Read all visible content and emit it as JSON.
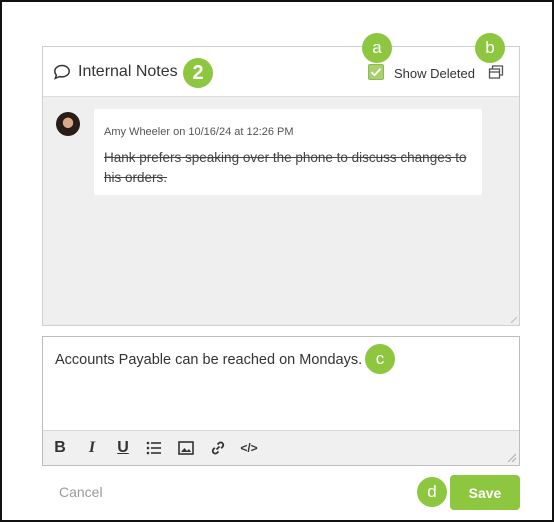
{
  "notes": {
    "title": "Internal Notes",
    "title_icon": "chat-bubble-icon",
    "show_deleted_label": "Show Deleted",
    "show_deleted_checked": true,
    "popout_icon": "popout-icon",
    "callout_title": "2",
    "callout_show_deleted": "a",
    "callout_popout": "b",
    "items": [
      {
        "author_meta": "Amy Wheeler on 10/16/24 at 12:26 PM",
        "text": "Hank prefers speaking over the phone to discuss changes to his orders.",
        "deleted": true
      }
    ]
  },
  "composer": {
    "value": "Accounts Payable can be reached on Mondays.",
    "callout": "c",
    "toolbar": {
      "bold": "B",
      "italic": "I",
      "underline": "U",
      "list_icon": "bullet-list-icon",
      "image_icon": "image-icon",
      "link_icon": "link-icon",
      "code_icon": "</>"
    }
  },
  "footer": {
    "cancel_label": "Cancel",
    "save_label": "Save",
    "callout_save": "d"
  },
  "colors": {
    "accent": "#8dc63f",
    "panel_bg": "#efefef"
  }
}
